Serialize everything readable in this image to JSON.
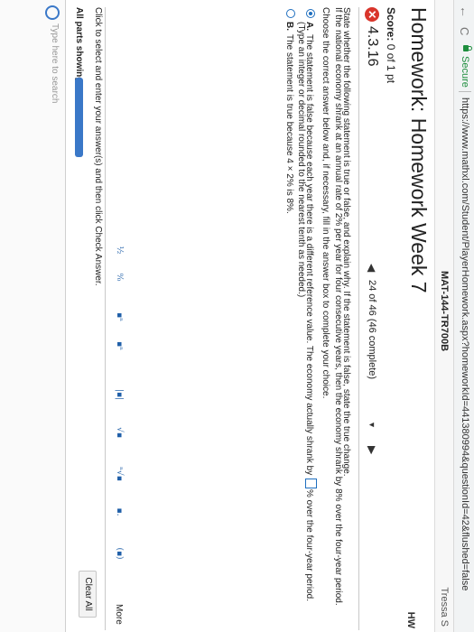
{
  "browser": {
    "secure_label": "Secure",
    "url": "https://www.mathxl.com/Student/PlayerHomework.aspx?homeworkId=441380994&questionId=42&flushed=false"
  },
  "course": {
    "title": "MAT-144-TR700B",
    "user": "Tressa S"
  },
  "page": {
    "title": "Homework: Homework Week 7",
    "hw_label": "HW",
    "score_label": "Score:",
    "score_value": "0 of 1 pt"
  },
  "question": {
    "number": "4.3.16",
    "progress": "24 of 46 (46 complete)",
    "statement": "State whether the following statement is true or false, and explain why. If the statement is false, state the true change.",
    "premise": "If the national economy shrank at an annual rate of 2% per year for four consecutive years, then the economy shrank by 8% over the four-year period.",
    "instruction": "Choose the correct answer below and, if necessary, fill in the answer box to complete your choice.",
    "options": [
      {
        "letter": "A.",
        "text_before": "The statement is false because each year there is a different reference value. The economy actually shrank by",
        "text_after": "% over the four-year period.",
        "subnote": "(Type an integer or decimal rounded to the nearest tenth as needed.)",
        "selected": true
      },
      {
        "letter": "B.",
        "text": "The statement is true because 4 × 2% is 8%.",
        "selected": false
      }
    ]
  },
  "palette": {
    "buttons": [
      "½",
      "⁰⁄₀",
      "▪ⁿ",
      "▪ⁿ",
      "|▪|",
      "√▪",
      "ⁿ√▪",
      "▪.",
      "(▪)"
    ],
    "more_label": "More"
  },
  "footer": {
    "instructions": "Click to select and enter your answer(s) and then click Check Answer.",
    "clear_label": "Clear All",
    "parts_label": "All parts showing",
    "bottom_text": "Type here to search"
  }
}
